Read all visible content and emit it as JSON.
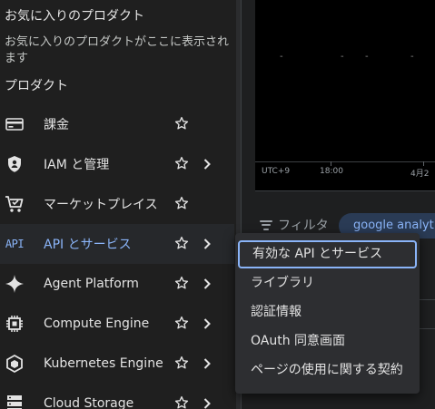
{
  "favorites": {
    "title": "お気に入りのプロダクト",
    "empty_text": "お気に入りのプロダクトがここに表示されます"
  },
  "products": {
    "title": "プロダクト",
    "items": [
      {
        "label": "課金",
        "icon": "billing-icon",
        "has_submenu": false
      },
      {
        "label": "IAM と管理",
        "icon": "shield-icon",
        "has_submenu": true
      },
      {
        "label": "マーケットプレイス",
        "icon": "cart-icon",
        "has_submenu": false
      },
      {
        "label": "API とサービス",
        "icon": "api-icon",
        "icon_text": "API",
        "has_submenu": true,
        "active": true
      },
      {
        "label": "Agent Platform",
        "icon": "sparkle-icon",
        "has_submenu": true
      },
      {
        "label": "Compute Engine",
        "icon": "chip-icon",
        "has_submenu": true
      },
      {
        "label": "Kubernetes Engine",
        "icon": "kubernetes-icon",
        "has_submenu": true
      },
      {
        "label": "Cloud Storage",
        "icon": "storage-icon",
        "has_submenu": true
      }
    ]
  },
  "submenu": {
    "items": [
      {
        "label": "有効な API とサービス",
        "selected": true
      },
      {
        "label": "ライブラリ"
      },
      {
        "label": "認証情報"
      },
      {
        "label": "OAuth 同意画面"
      },
      {
        "label": "ページの使用に関する契約"
      }
    ]
  },
  "background": {
    "chart": {
      "dashes": [
        "-",
        "-",
        "-",
        "-"
      ],
      "x_labels": [
        "UTC+9",
        "18:00",
        "4月2"
      ]
    },
    "filter_label": "フィルタ",
    "chip_text": "google analyt"
  },
  "colors": {
    "accent": "#8ab4f8",
    "panel_bg": "#1f1f1f",
    "submenu_bg": "#2d2e31"
  }
}
